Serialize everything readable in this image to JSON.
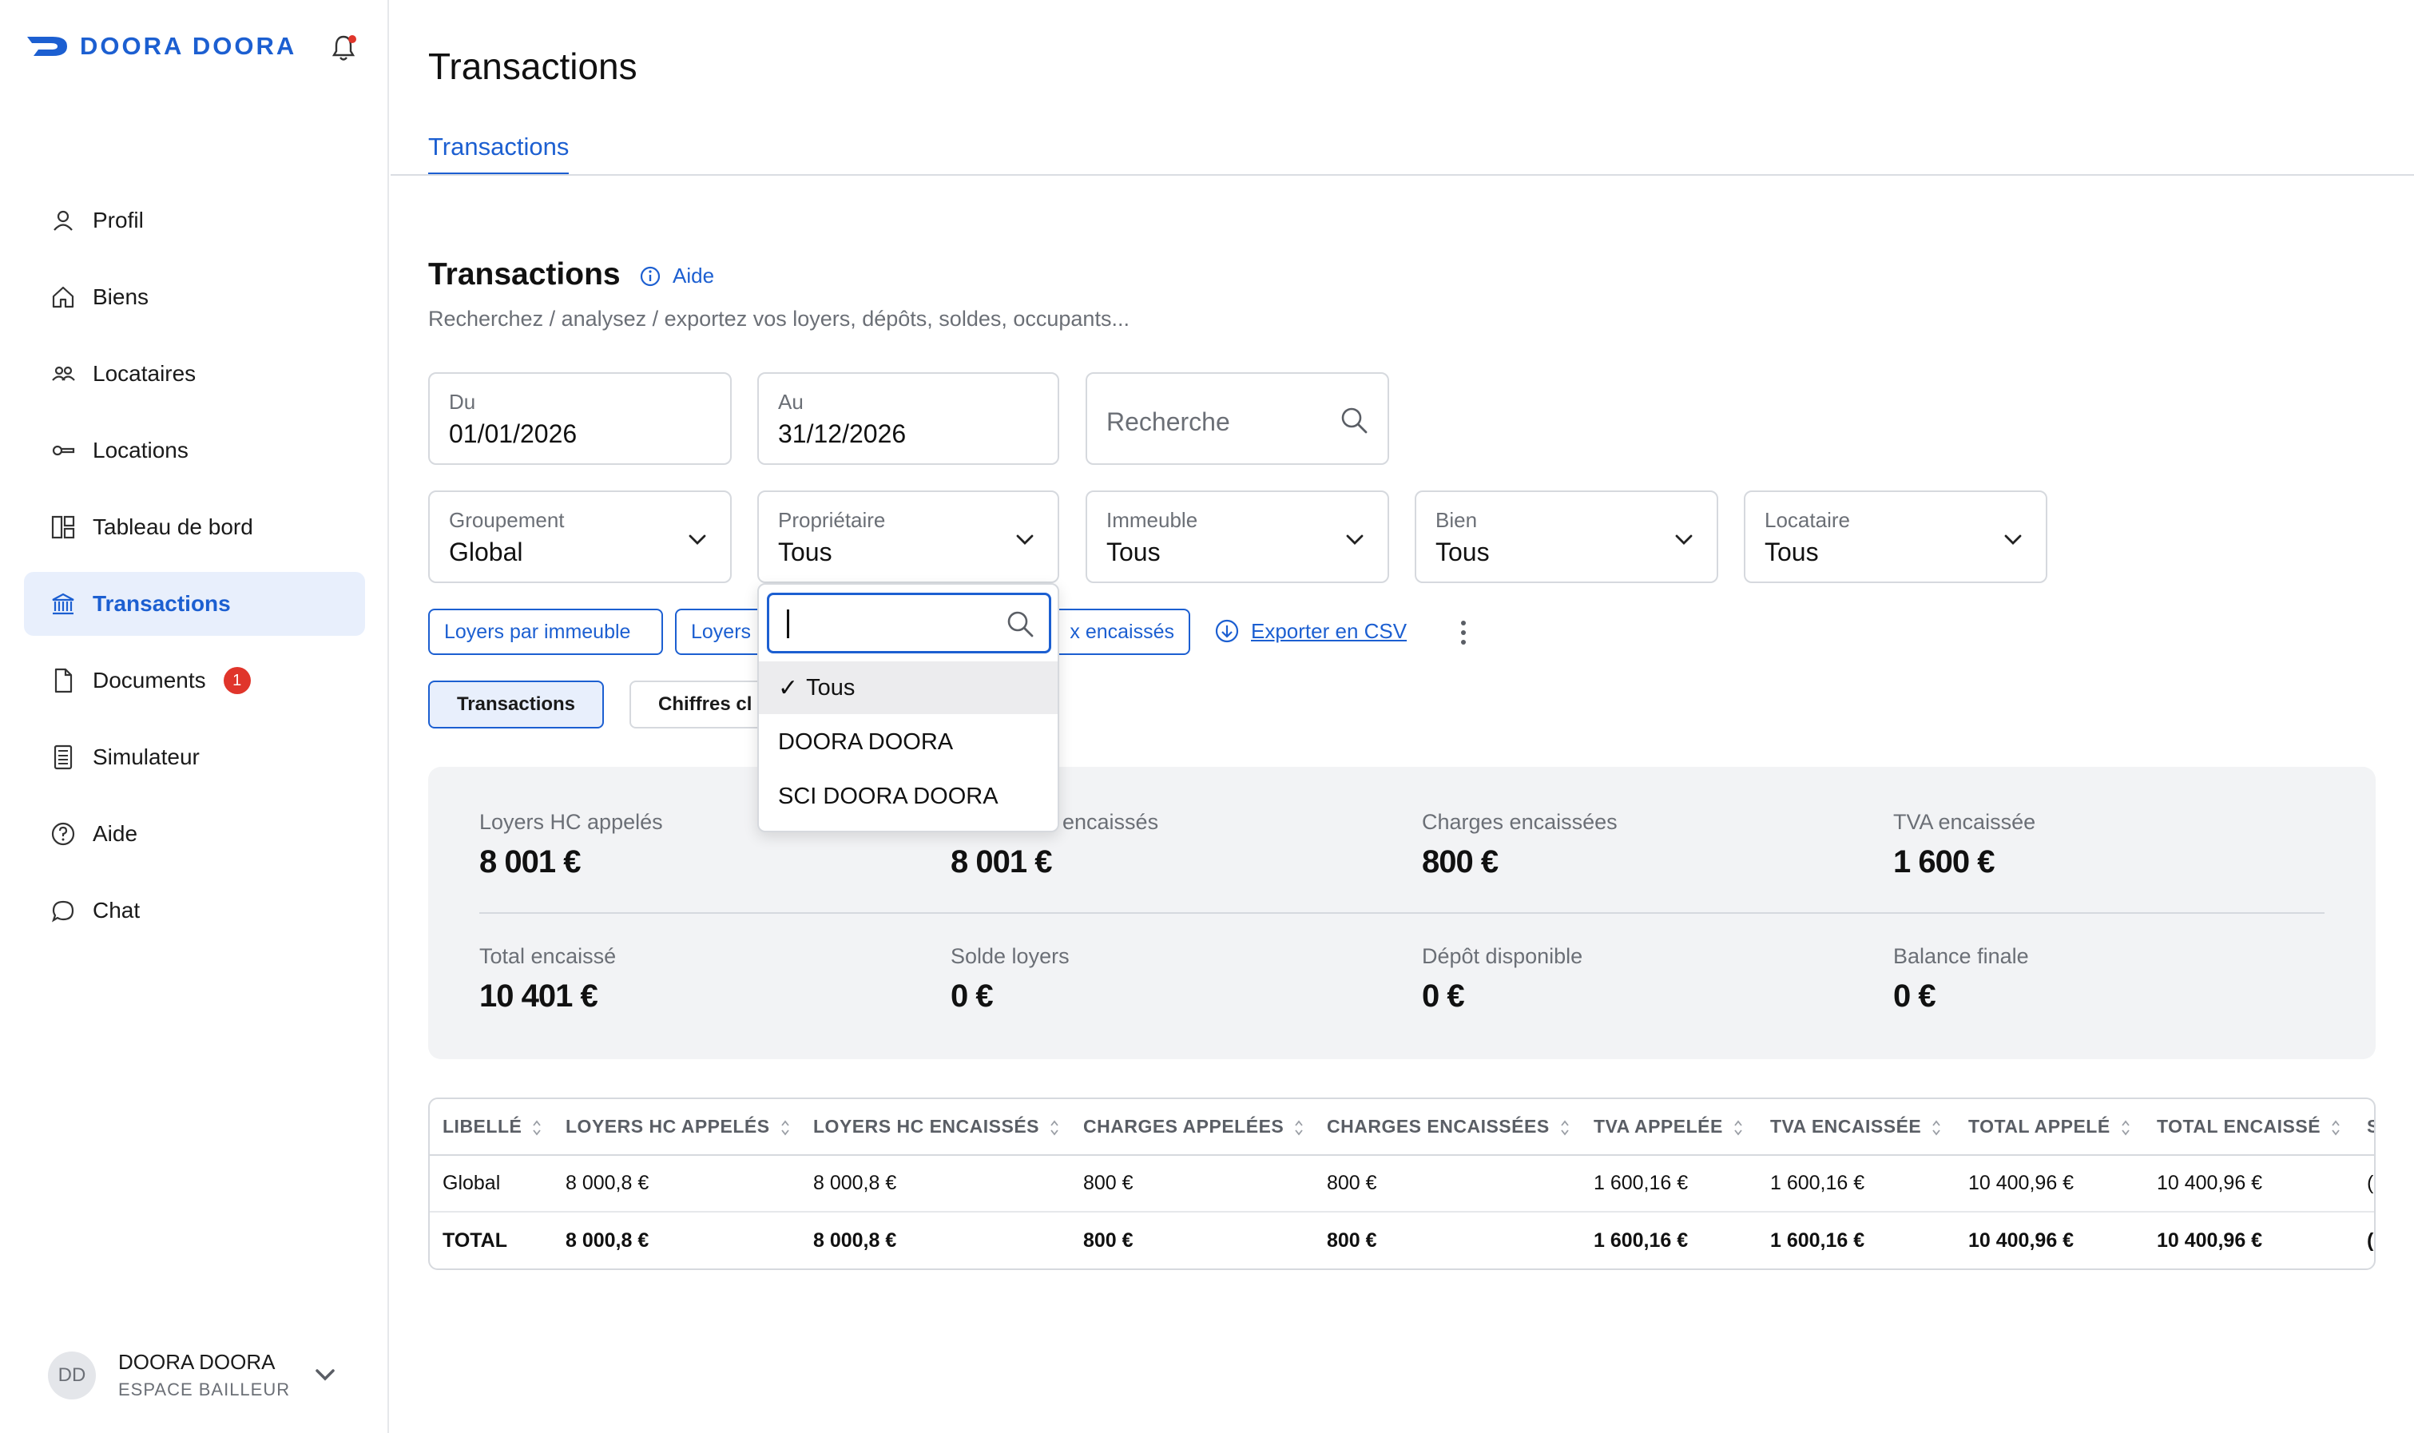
{
  "brand": {
    "name": "DOORA DOORA",
    "accent": "#1c5fd1",
    "danger": "#e0352b"
  },
  "sidebar": {
    "items": [
      {
        "label": "Profil",
        "icon": "user-icon"
      },
      {
        "label": "Biens",
        "icon": "home-icon"
      },
      {
        "label": "Locataires",
        "icon": "users-icon"
      },
      {
        "label": "Locations",
        "icon": "key-icon"
      },
      {
        "label": "Tableau de bord",
        "icon": "dashboard-icon"
      },
      {
        "label": "Transactions",
        "icon": "bank-icon",
        "active": true
      },
      {
        "label": "Documents",
        "icon": "document-icon",
        "badge": "1"
      },
      {
        "label": "Simulateur",
        "icon": "calculator-icon"
      },
      {
        "label": "Aide",
        "icon": "help-circle-icon"
      },
      {
        "label": "Chat",
        "icon": "chat-icon"
      }
    ],
    "user": {
      "initials": "DD",
      "name": "DOORA DOORA",
      "role": "ESPACE BAILLEUR"
    }
  },
  "header": {
    "title": "Transactions",
    "tab": "Transactions"
  },
  "section": {
    "title": "Transactions",
    "help": "Aide",
    "subtitle": "Recherchez / analysez / exportez vos loyers, dépôts, soldes, occupants..."
  },
  "filters": {
    "from": {
      "label": "Du",
      "value": "01/01/2026"
    },
    "to": {
      "label": "Au",
      "value": "31/12/2026"
    },
    "search": {
      "placeholder": "Recherche"
    },
    "grouping": {
      "label": "Groupement",
      "value": "Global"
    },
    "owner": {
      "label": "Propriétaire",
      "value": "Tous"
    },
    "building": {
      "label": "Immeuble",
      "value": "Tous"
    },
    "property": {
      "label": "Bien",
      "value": "Tous"
    },
    "tenant": {
      "label": "Locataire",
      "value": "Tous"
    }
  },
  "chips": {
    "loyers_immeuble": "Loyers par immeuble",
    "loyers": "Loyers",
    "encaisses": "x encaissés"
  },
  "export_label": "Exporter en CSV",
  "views": {
    "transactions": "Transactions",
    "chiffres": "Chiffres cl"
  },
  "stats": {
    "loyers_hc_appeles": {
      "label": "Loyers HC appelés",
      "value": "8 001 €"
    },
    "loyers_hc_encaisses": {
      "label": "encaissés",
      "value": "8 001 €"
    },
    "charges_encaissees": {
      "label": "Charges encaissées",
      "value": "800 €"
    },
    "tva_encaissee": {
      "label": "TVA encaissée",
      "value": "1 600 €"
    },
    "total_encaisse": {
      "label": "Total encaissé",
      "value": "10 401 €"
    },
    "solde_loyers": {
      "label": "Solde loyers",
      "value": "0 €"
    },
    "depot_disponible": {
      "label": "Dépôt disponible",
      "value": "0 €"
    },
    "balance_finale": {
      "label": "Balance finale",
      "value": "0 €"
    }
  },
  "table": {
    "headers": [
      "LIBELLÉ",
      "LOYERS HC APPELÉS",
      "LOYERS HC ENCAISSÉS",
      "CHARGES APPELÉES",
      "CHARGES ENCAISSÉES",
      "TVA APPELÉE",
      "TVA ENCAISSÉE",
      "TOTAL APPELÉ",
      "TOTAL ENCAISSÉ",
      "S"
    ],
    "rows": [
      [
        "Global",
        "8 000,8 €",
        "8 000,8 €",
        "800 €",
        "800 €",
        "1 600,16 €",
        "1 600,16 €",
        "10 400,96 €",
        "10 400,96 €",
        "("
      ],
      [
        "TOTAL",
        "8 000,8 €",
        "8 000,8 €",
        "800 €",
        "800 €",
        "1 600,16 €",
        "1 600,16 €",
        "10 400,96 €",
        "10 400,96 €",
        "("
      ]
    ]
  },
  "dropdown": {
    "options": [
      {
        "label": "Tous",
        "checkmark": "✓",
        "selected": true
      },
      {
        "label": "DOORA DOORA"
      },
      {
        "label": "SCI DOORA DOORA"
      }
    ]
  }
}
